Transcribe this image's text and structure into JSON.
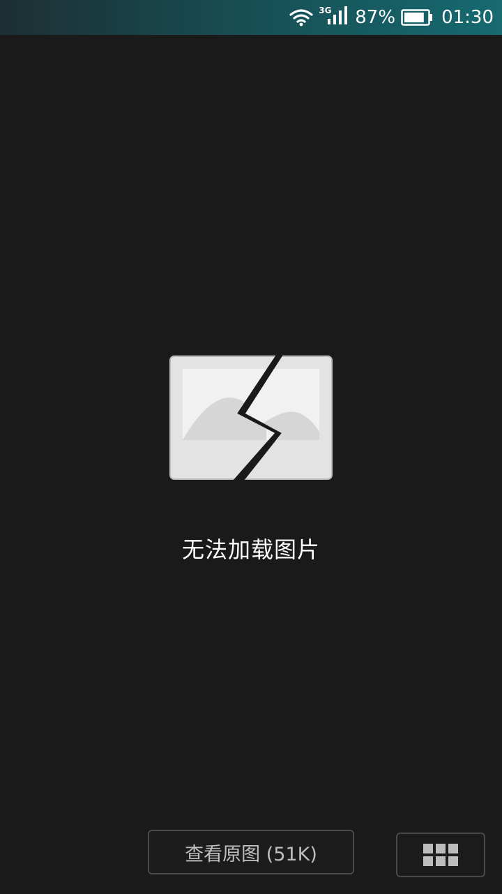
{
  "status_bar": {
    "network_type": "3G",
    "battery_percent": "87%",
    "battery_level": 0.87,
    "time": "01:30",
    "icons": [
      "wifi-icon",
      "signal-icon",
      "battery-icon"
    ]
  },
  "main": {
    "error_message": "无法加载图片",
    "broken_image_icon": "broken-image-icon"
  },
  "bottom_bar": {
    "view_original_label": "查看原图 (51K)",
    "grid_icon": "grid-icon"
  },
  "colors": {
    "background": "#1a1a1a",
    "status_bar_accent": "#166a70",
    "button_border": "#4a4a4a",
    "button_text": "#bfbfbf"
  }
}
